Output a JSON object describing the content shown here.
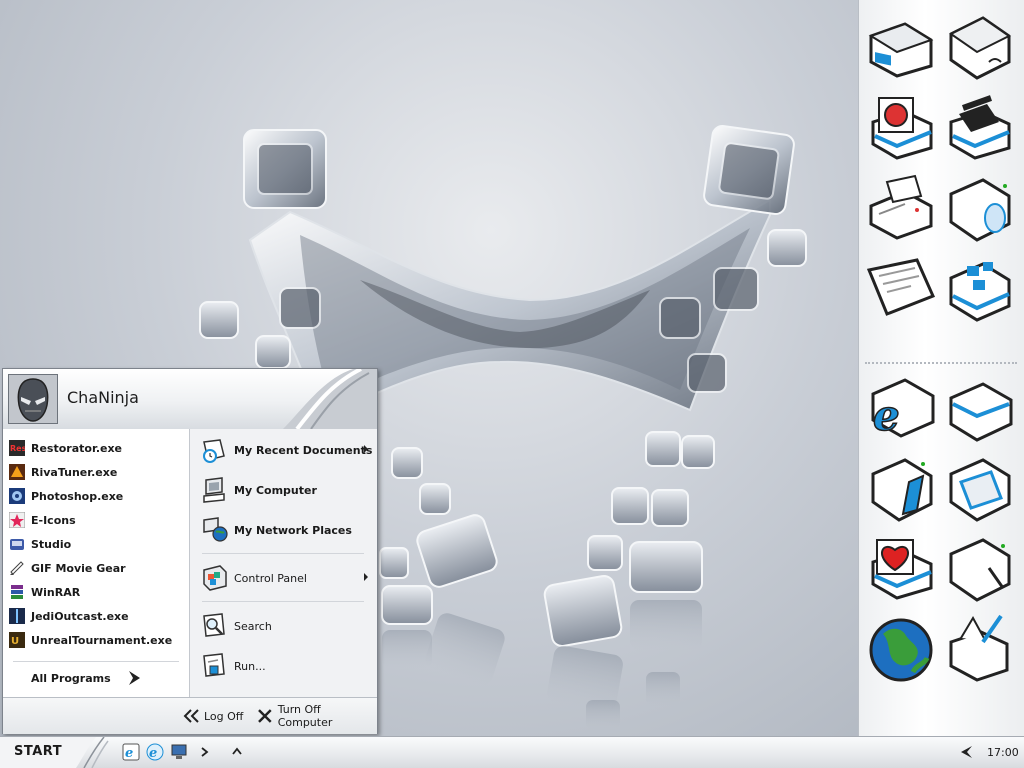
{
  "user": {
    "name": "ChaNinja"
  },
  "recent_programs": [
    {
      "label": "Restorator.exe",
      "icon": "restorator-icon"
    },
    {
      "label": "RivaTuner.exe",
      "icon": "rivatuner-icon"
    },
    {
      "label": "Photoshop.exe",
      "icon": "photoshop-icon"
    },
    {
      "label": "E-Icons",
      "icon": "e-icons-icon"
    },
    {
      "label": "Studio",
      "icon": "studio-icon"
    },
    {
      "label": "GIF Movie Gear",
      "icon": "gif-movie-gear-icon"
    },
    {
      "label": "WinRAR",
      "icon": "winrar-icon"
    },
    {
      "label": "JediOutcast.exe",
      "icon": "jedi-outcast-icon"
    },
    {
      "label": "UnrealTournament.exe",
      "icon": "unreal-tournament-icon"
    }
  ],
  "all_programs_label": "All Programs",
  "places": [
    {
      "label": "My Recent Documents",
      "icon": "recent-documents-icon",
      "submenu": true
    },
    {
      "label": "My Computer",
      "icon": "my-computer-icon",
      "submenu": false
    },
    {
      "label": "My Network Places",
      "icon": "network-places-icon",
      "submenu": false
    },
    {
      "label": "Control Panel",
      "icon": "control-panel-icon",
      "submenu": true
    },
    {
      "label": "Search",
      "icon": "search-icon",
      "submenu": false
    },
    {
      "label": "Run...",
      "icon": "run-icon",
      "submenu": false
    }
  ],
  "footer": {
    "log_off_label": "Log Off",
    "turn_off_label": "Turn Off Computer"
  },
  "taskbar": {
    "start_label": "START",
    "quick_launch": [
      "internet-explorer-icon",
      "internet-explorer-alt-icon",
      "show-desktop-icon"
    ],
    "clock": "17:00"
  },
  "dock": {
    "tiles": [
      "printer-box-icon",
      "hardware-box-icon",
      "image-viewer-icon",
      "media-clapper-icon",
      "printer-icon",
      "disc-drive-icon",
      "document-icon",
      "network-box-icon",
      "internet-explorer-box-icon",
      "generic-box-icon",
      "portable-device-icon",
      "open-box-icon",
      "favorites-heart-icon",
      "tools-box-icon",
      "globe-icon",
      "notes-box-icon"
    ]
  },
  "colors": {
    "accent": "#1c8fd6",
    "menu_border": "#7d838c",
    "taskbar": "#e7e9ec"
  }
}
